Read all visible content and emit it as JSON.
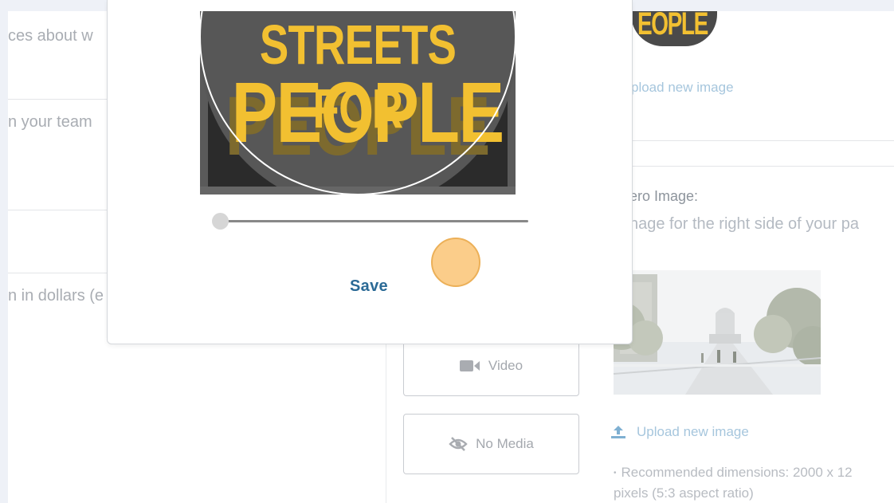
{
  "left_fields": {
    "field1_text": "ces about w",
    "field2_text": "n your team",
    "field3_text": "n in dollars (e"
  },
  "media_options": {
    "video_label": "Video",
    "video_icon": "video-camera-icon",
    "no_media_label": "No Media",
    "no_media_icon": "eye-slash-icon"
  },
  "right_panel": {
    "upload_top": "pload new image",
    "hero_title": "ero Image:",
    "hero_subtitle": "nage for the right side of your pa",
    "upload_label": "Upload new image",
    "upload_icon": "upload-icon",
    "recommendation_line1": "Recommended dimensions: 2000 x 12",
    "recommendation_line2": "pixels (5:3 aspect ratio)"
  },
  "modal": {
    "logo_line1": "STREETS FOR",
    "logo_line2": "PEOPLE",
    "save_label": "Save",
    "zoom_level": 0
  },
  "thumbnail_logo_text": "EOPLE",
  "colors": {
    "logo_yellow": "#f2c031",
    "logo_bg": "#5c5c5c",
    "link_blue": "#2b6a96",
    "click_indicator": "#fac476"
  }
}
